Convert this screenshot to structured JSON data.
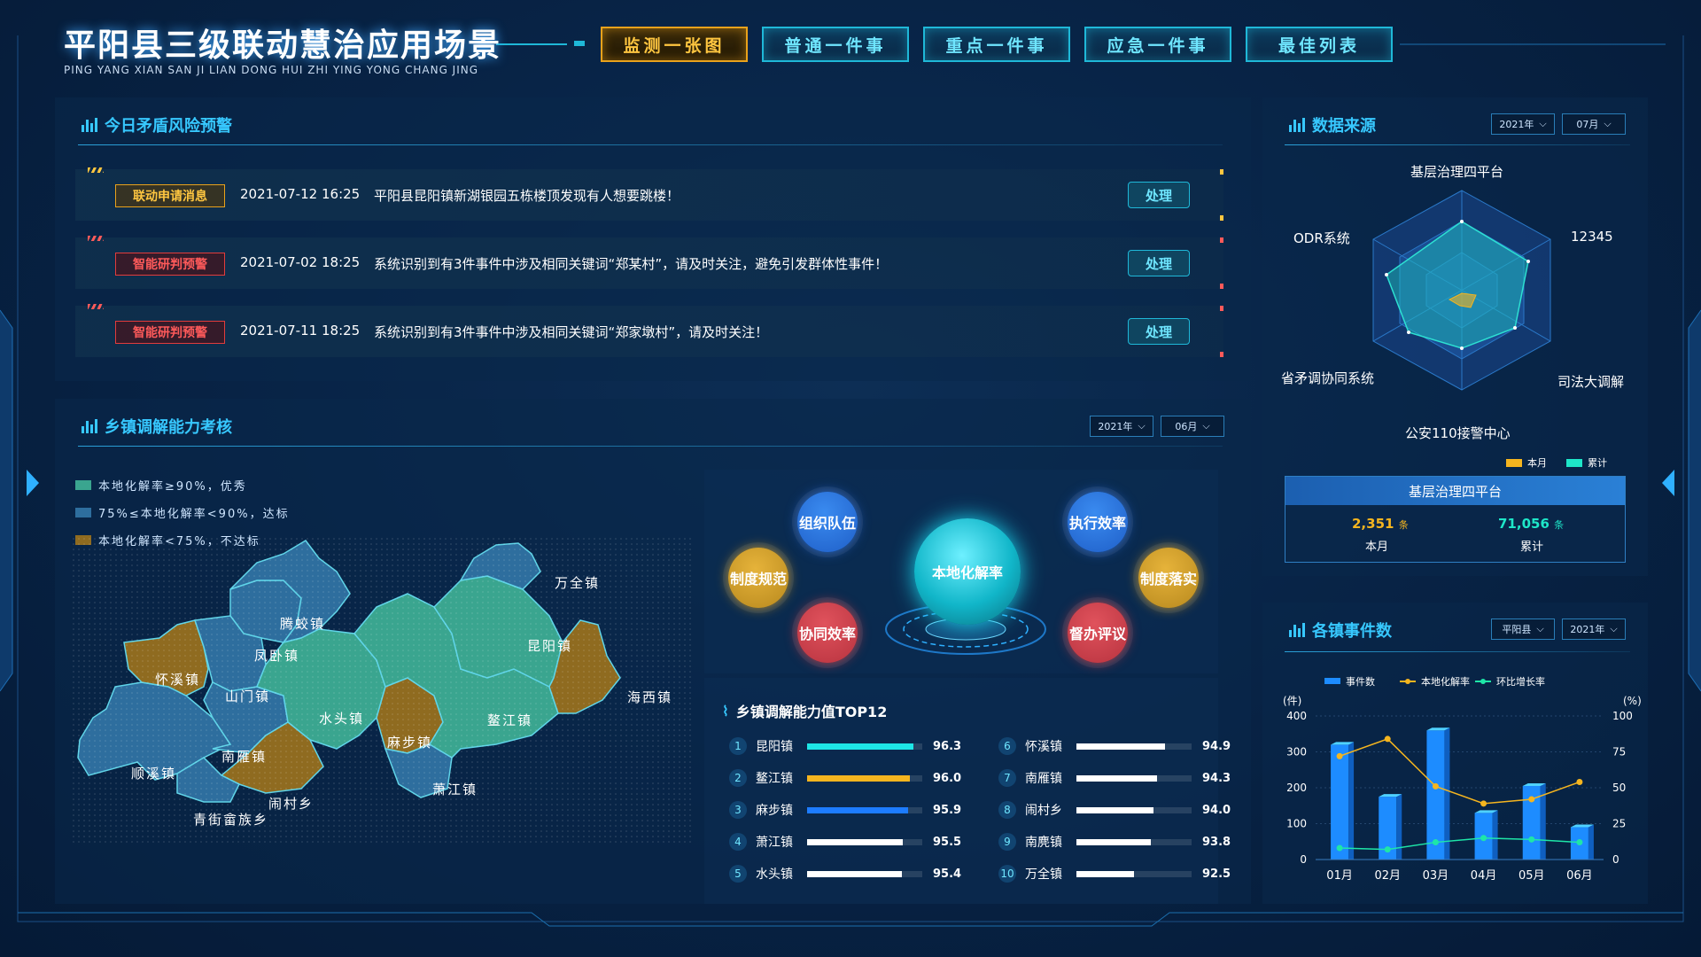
{
  "header": {
    "title": "平阳县三级联动慧治应用场景",
    "subtitle": "PING YANG XIAN SAN JI LIAN DONG HUI ZHI YING YONG CHANG JING",
    "nav": [
      "监测一张图",
      "普通一件事",
      "重点一件事",
      "应急一件事",
      "最佳列表"
    ],
    "active_index": 0
  },
  "warning_panel": {
    "title": "今日矛盾风险预警",
    "rows": [
      {
        "tag": "联动申请消息",
        "tag_color": "#ffc640",
        "date": "2021-07-12",
        "time": "16:25",
        "message": "平阳县昆阳镇新湖银园五栋楼顶发现有人想要跳楼！",
        "action": "处理"
      },
      {
        "tag": "智能研判预警",
        "tag_color": "#ff5a5a",
        "date": "2021-07-02",
        "time": "18:25",
        "message": "系统识别到有3件事件中涉及相同关键词“郑某村”，请及时关注，避免引发群体性事件！",
        "action": "处理"
      },
      {
        "tag": "智能研判预警",
        "tag_color": "#ff5a5a",
        "date": "2021-07-11",
        "time": "18:25",
        "message": "系统识别到有3件事件中涉及相同关键词“郑家墩村”，请及时关注！",
        "action": "处理"
      }
    ]
  },
  "town_panel": {
    "title": "乡镇调解能力考核",
    "year": "2021年",
    "month": "06月",
    "legend": [
      {
        "label": "本地化解率≥90%，优秀",
        "color": "#3aa58f"
      },
      {
        "label": "75%≤本地化解率<90%，达标",
        "color": "#2e6e9e"
      },
      {
        "label": "本地化解率<75%，不达标",
        "color": "#8f6b20"
      }
    ],
    "towns": [
      "万全镇",
      "腾蛟镇",
      "凤卧镇",
      "怀溪镇",
      "昆阳镇",
      "山门镇",
      "水头镇",
      "海西镇",
      "鳌江镇",
      "南雁镇",
      "顺溪镇",
      "麻步镇",
      "闹村乡",
      "萧江镇",
      "青街畲族乡"
    ],
    "bubbles": {
      "center": "本地化解率",
      "items": [
        "组织队伍",
        "执行效率",
        "制度规范",
        "制度落实",
        "协同效率",
        "督办评议"
      ]
    },
    "ranking": {
      "title": "乡镇调解能力值TOP12",
      "items": [
        {
          "no": "1",
          "name": "昆阳镇",
          "value": "96.3"
        },
        {
          "no": "2",
          "name": "鳌江镇",
          "value": "96.0"
        },
        {
          "no": "3",
          "name": "麻步镇",
          "value": "95.9"
        },
        {
          "no": "4",
          "name": "萧江镇",
          "value": "95.5"
        },
        {
          "no": "5",
          "name": "水头镇",
          "value": "95.4"
        },
        {
          "no": "6",
          "name": "怀溪镇",
          "value": "94.9"
        },
        {
          "no": "7",
          "name": "南雁镇",
          "value": "94.3"
        },
        {
          "no": "8",
          "name": "闹村乡",
          "value": "94.0"
        },
        {
          "no": "9",
          "name": "南麂镇",
          "value": "93.8"
        },
        {
          "no": "10",
          "name": "万全镇",
          "value": "92.5"
        }
      ]
    }
  },
  "source_panel": {
    "title": "数据来源",
    "year": "2021年",
    "month": "07月",
    "radar_labels": [
      "基层治理四平台",
      "12345",
      "司法大调解",
      "公安110接警中心",
      "省矛调协同系统",
      "ODR系统"
    ],
    "legend": [
      "本月",
      "累计"
    ],
    "summary": {
      "title": "基层治理四平台",
      "month_value": "2,351",
      "month_unit": "条",
      "month_label": "本月",
      "total_value": "71,056",
      "total_unit": "条",
      "total_label": "累计"
    }
  },
  "events_panel": {
    "title": "各镇事件数",
    "region": "平阳县",
    "year": "2021年"
  },
  "chart_data": {
    "type": "bar",
    "categories": [
      "01月",
      "02月",
      "03月",
      "04月",
      "05月",
      "06月"
    ],
    "series": [
      {
        "name": "事件数",
        "type": "bar",
        "axis": "left",
        "values": [
          320,
          175,
          360,
          130,
          205,
          90
        ]
      },
      {
        "name": "本地化解率",
        "type": "line",
        "axis": "right",
        "values": [
          72,
          84,
          51,
          39,
          42,
          54
        ]
      },
      {
        "name": "环比增长率",
        "type": "line",
        "axis": "right",
        "values": [
          8,
          7,
          12,
          15,
          14,
          12
        ]
      }
    ],
    "ylabel_left": "(件)",
    "ylabel_right": "(%)",
    "ylim_left": [
      0,
      400
    ],
    "ylim_right": [
      0,
      100
    ],
    "yticks_left": [
      "0",
      "100",
      "200",
      "300",
      "400"
    ],
    "yticks_right": [
      "0",
      "25",
      "50",
      "75",
      "100"
    ],
    "colors": {
      "bar": "#1d8cff",
      "rate": "#f5b51f",
      "growth": "#1ee6a8"
    },
    "grid": true,
    "legend_position": "top"
  }
}
